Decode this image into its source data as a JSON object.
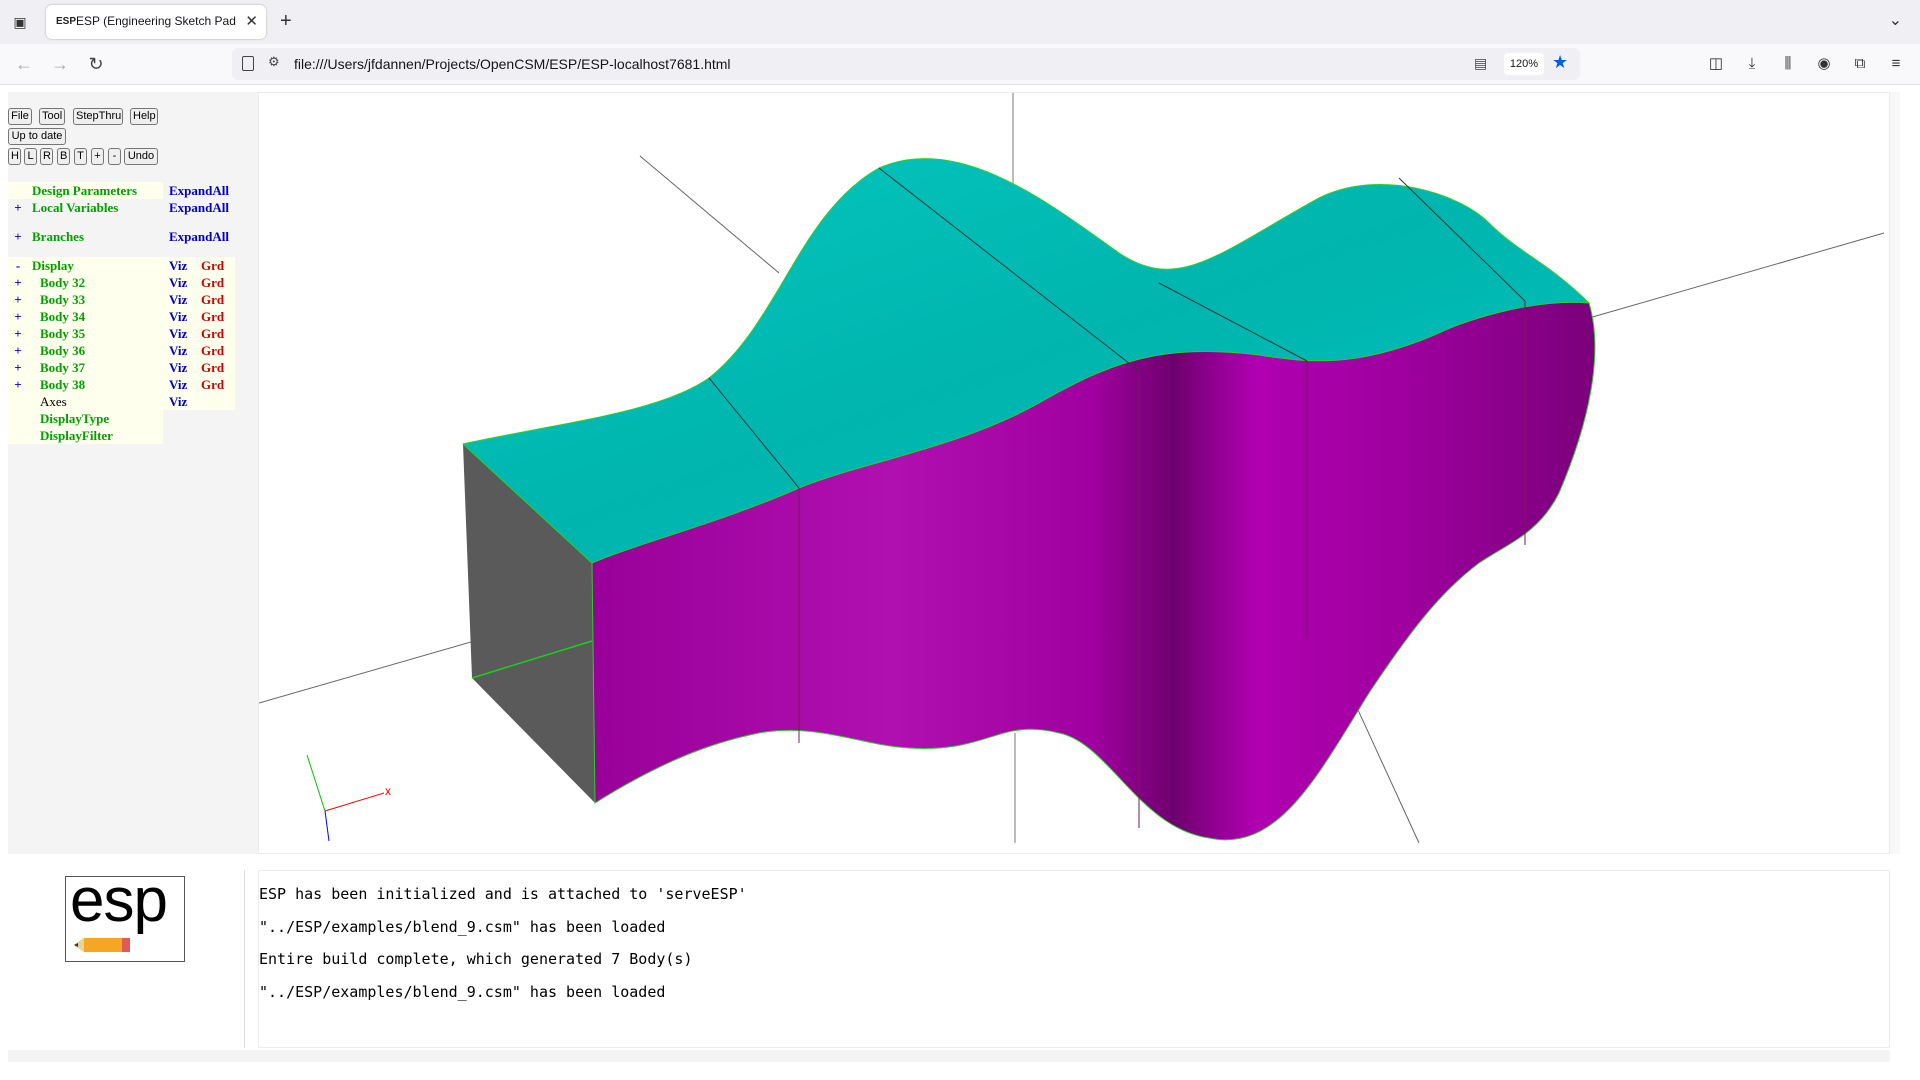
{
  "browser": {
    "tab_title": "ESP (Engineering Sketch Pad, V",
    "tab_favicon": "ESP",
    "url": "file:///Users/jfdannen/Projects/OpenCSM/ESP/ESP-localhost7681.html",
    "zoom": "120%"
  },
  "toolbar": {
    "row1": [
      "File",
      "Tool",
      "StepThru",
      "Help"
    ],
    "status_button": "Up to date",
    "row3": [
      "H",
      "L",
      "R",
      "B",
      "T",
      "+",
      "-",
      "Undo"
    ]
  },
  "tree": {
    "design_parameters": {
      "label": "Design Parameters",
      "expand": "ExpandAll"
    },
    "local_variables": {
      "sign": "+",
      "label": "Local Variables",
      "expand": "ExpandAll"
    },
    "branches": {
      "sign": "+",
      "label": "Branches",
      "expand": "ExpandAll"
    },
    "display": {
      "sign": "-",
      "label": "Display",
      "viz": "Viz",
      "grd": "Grd"
    },
    "bodies": [
      {
        "sign": "+",
        "label": "Body 32",
        "viz": "Viz",
        "grd": "Grd"
      },
      {
        "sign": "+",
        "label": "Body 33",
        "viz": "Viz",
        "grd": "Grd"
      },
      {
        "sign": "+",
        "label": "Body 34",
        "viz": "Viz",
        "grd": "Grd"
      },
      {
        "sign": "+",
        "label": "Body 35",
        "viz": "Viz",
        "grd": "Grd"
      },
      {
        "sign": "+",
        "label": "Body 36",
        "viz": "Viz",
        "grd": "Grd"
      },
      {
        "sign": "+",
        "label": "Body 37",
        "viz": "Viz",
        "grd": "Grd"
      },
      {
        "sign": "+",
        "label": "Body 38",
        "viz": "Viz",
        "grd": "Grd"
      }
    ],
    "axes": {
      "label": "Axes",
      "viz": "Viz"
    },
    "display_type": "DisplayType",
    "display_filter": "DisplayFilter"
  },
  "logo_text": "esp",
  "axis_triad_label": "x",
  "messages": [
    "ESP has been initialized and is attached to 'serveESP'",
    "\"../ESP/examples/blend_9.csm\" has been loaded",
    "Entire build complete, which generated 7 Body(s)",
    "\"../ESP/examples/blend_9.csm\" has been loaded"
  ],
  "colors": {
    "top_face": "#00c8c0",
    "side_face": "#b000b0",
    "end_face": "#555555",
    "tree_green": "#00a000",
    "tree_blue": "#0000cc",
    "tree_red": "#d00000"
  }
}
